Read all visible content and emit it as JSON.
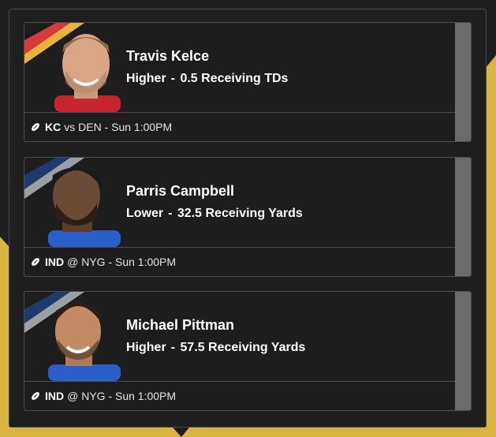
{
  "colors": {
    "background": "#1e1e1e",
    "card_background": "#1d1d1d",
    "card_border": "#4e4e4e",
    "scrollbar": "#6b6b6b",
    "accent_yellow": "#d9b441",
    "chiefs_red": "#d63a3a",
    "colts_blue": "#1f3b6e",
    "stripe_gray": "#9aa0a6"
  },
  "picks": [
    {
      "player": "Travis Kelce",
      "direction": "Higher",
      "separator": "-",
      "line": "0.5",
      "stat": "Receiving TDs",
      "team": "KC",
      "matchup": "vs DEN - Sun 1:00PM",
      "icon": "football-icon",
      "stripe_colors": [
        "#d63a3a",
        "#e6b43c"
      ],
      "jersey_color": "#c8242d"
    },
    {
      "player": "Parris Campbell",
      "direction": "Lower",
      "separator": "-",
      "line": "32.5",
      "stat": "Receiving Yards",
      "team": "IND",
      "matchup": "@ NYG - Sun 1:00PM",
      "icon": "football-icon",
      "stripe_colors": [
        "#1f3b6e",
        "#9aa0a6"
      ],
      "jersey_color": "#2b5ec9"
    },
    {
      "player": "Michael Pittman",
      "direction": "Higher",
      "separator": "-",
      "line": "57.5",
      "stat": "Receiving Yards",
      "team": "IND",
      "matchup": "@ NYG - Sun 1:00PM",
      "icon": "football-icon",
      "stripe_colors": [
        "#1f3b6e",
        "#9aa0a6"
      ],
      "jersey_color": "#2b5ec9"
    }
  ]
}
